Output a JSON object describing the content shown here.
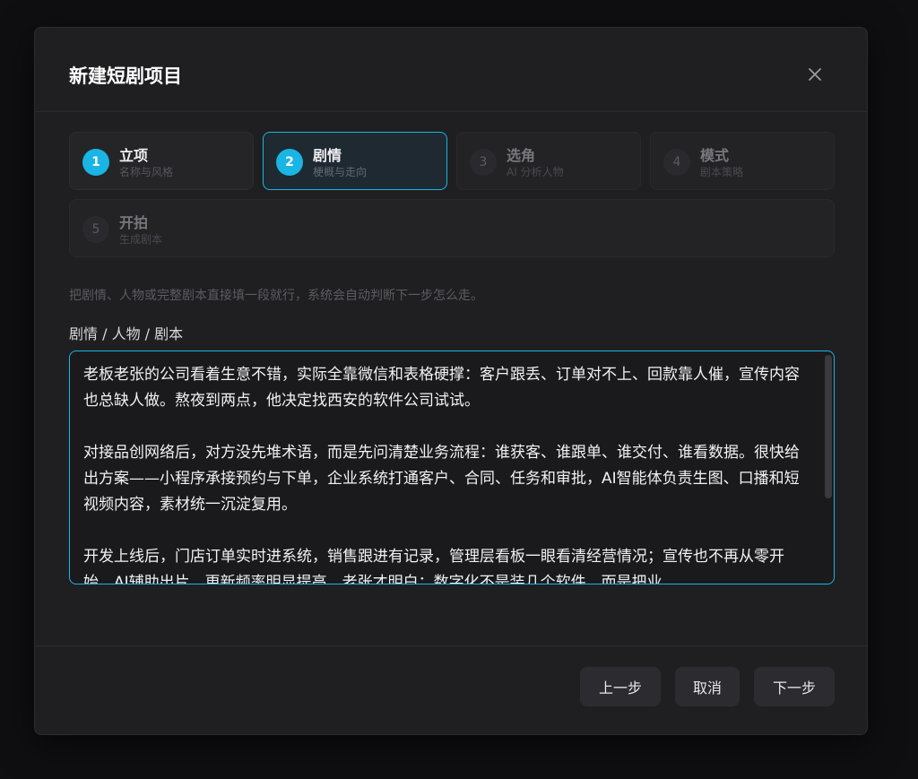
{
  "modal": {
    "title": "新建短剧项目",
    "close_icon": "close-icon"
  },
  "steps": [
    {
      "num": "1",
      "label": "立项",
      "sub": "名称与风格",
      "state": "done"
    },
    {
      "num": "2",
      "label": "剧情",
      "sub": "梗概与走向",
      "state": "active"
    },
    {
      "num": "3",
      "label": "选角",
      "sub": "AI 分析人物",
      "state": "disabled"
    },
    {
      "num": "4",
      "label": "模式",
      "sub": "剧本策略",
      "state": "disabled"
    },
    {
      "num": "5",
      "label": "开拍",
      "sub": "生成剧本",
      "state": "disabled"
    }
  ],
  "form": {
    "hint": "把剧情、人物或完整剧本直接填一段就行，系统会自动判断下一步怎么走。",
    "label": "剧情 / 人物 / 剧本",
    "value": "老板老张的公司看着生意不错，实际全靠微信和表格硬撑：客户跟丢、订单对不上、回款靠人催，宣传内容也总缺人做。熬夜到两点，他决定找西安的软件公司试试。\n\n对接品创网络后，对方没先堆术语，而是先问清楚业务流程：谁获客、谁跟单、谁交付、谁看数据。很快给出方案——小程序承接预约与下单，企业系统打通客户、合同、任务和审批，AI智能体负责生图、口播和短视频内容，素材统一沉淀复用。\n\n开发上线后，门店订单实时进系统，销售跟进有记录，管理层看板一眼看清经营情况；宣传也不再从零开始，AI辅助出片，更新频率明显提高。老张才明白：数字化不是装几个软件，而是把业"
  },
  "footer": {
    "prev": "上一步",
    "cancel": "取消",
    "next": "下一步"
  },
  "colors": {
    "accent": "#19b5e4",
    "background": "#1f1f22"
  }
}
